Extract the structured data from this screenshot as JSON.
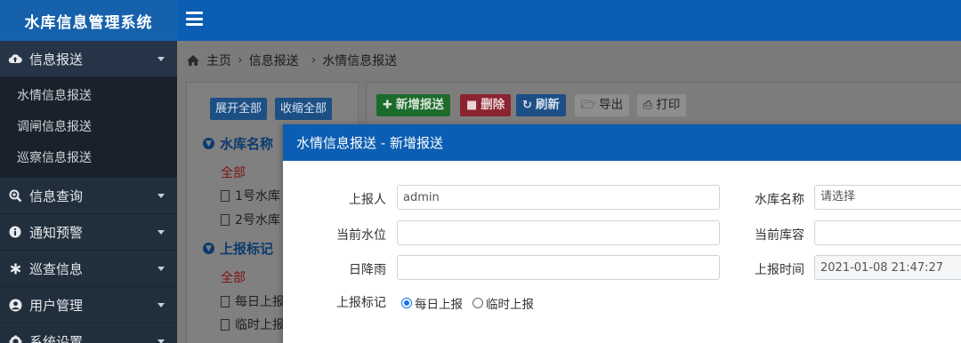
{
  "app": {
    "title": "水库信息管理系统"
  },
  "sidebar": {
    "menus": [
      {
        "label": "信息报送",
        "icon": "cloud-upload-icon",
        "active": true,
        "items": [
          "水情信息报送",
          "调闸信息报送",
          "巡察信息报送"
        ]
      },
      {
        "label": "信息查询",
        "icon": "search-plus-icon"
      },
      {
        "label": "通知预警",
        "icon": "info-icon"
      },
      {
        "label": "巡查信息",
        "icon": "asterisk-icon"
      },
      {
        "label": "用户管理",
        "icon": "user-circle-icon"
      },
      {
        "label": "系统设置",
        "icon": "gear-icon"
      }
    ]
  },
  "breadcrumb": {
    "home": "主页",
    "level1": "信息报送",
    "level2": "水情信息报送"
  },
  "tree": {
    "expand_all": "展开全部",
    "collapse_all": "收缩全部",
    "group1": {
      "title": "水库名称",
      "all": "全部",
      "leaves": [
        "1号水库",
        "2号水库"
      ]
    },
    "group2": {
      "title": "上报标记",
      "all": "全部",
      "leaves": [
        "每日上报",
        "临时上报"
      ]
    }
  },
  "toolbar": {
    "add": "新增报送",
    "delete": "删除",
    "refresh": "刷新",
    "export": "导出",
    "print": "打印"
  },
  "modal": {
    "title": "水情信息报送 - 新增报送",
    "reporter_label": "上报人",
    "reporter_value": "admin",
    "reservoir_label": "水库名称",
    "reservoir_placeholder": "请选择",
    "level_label": "当前水位",
    "capacity_label": "当前库容",
    "rain_label": "日降雨",
    "time_label": "上报时间",
    "time_value": "2021-01-08 21:47:27",
    "mark_label": "上报标记",
    "mark_options": [
      "每日上报",
      "临时上报"
    ],
    "mark_selected": "每日上报"
  },
  "colors": {
    "primary": "#0b5eb3",
    "sidebar": "#212f3d",
    "success": "#28a745",
    "danger": "#dc3545",
    "info": "#2e7bd1"
  }
}
